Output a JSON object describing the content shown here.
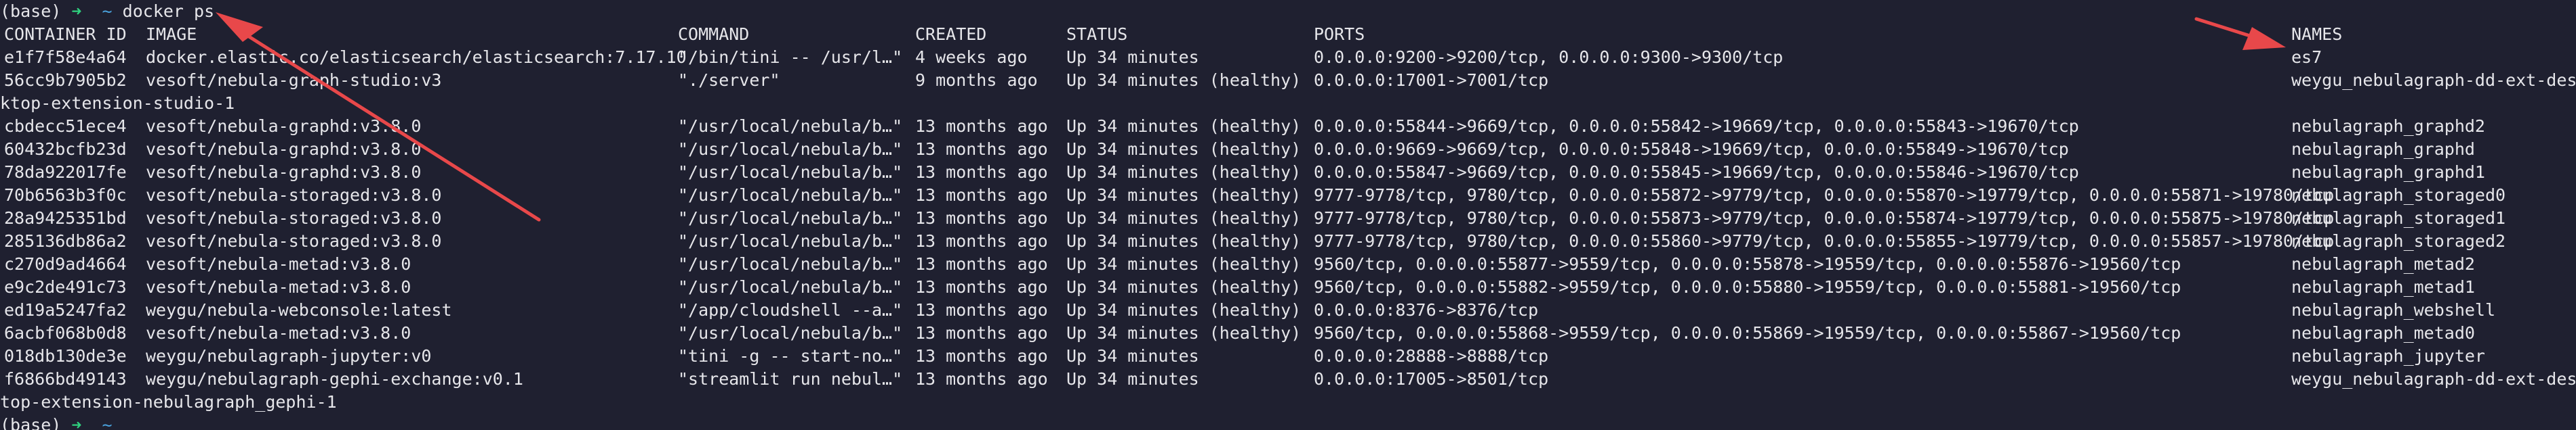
{
  "prompt_top": {
    "env": "(base)",
    "arrow": "➜",
    "cwd": "~",
    "command": "docker ps"
  },
  "headers": {
    "container_id": "CONTAINER ID",
    "image": "IMAGE",
    "command": "COMMAND",
    "created": "CREATED",
    "status": "STATUS",
    "ports": "PORTS",
    "names": "NAMES"
  },
  "rows": [
    {
      "container_id": "e1f7f58e4a64",
      "image": "docker.elastic.co/elasticsearch/elasticsearch:7.17.10",
      "command": "\"/bin/tini -- /usr/l…\"",
      "created": "4 weeks ago",
      "status": "Up 34 minutes",
      "ports": "0.0.0.0:9200->9200/tcp, 0.0.0.0:9300->9300/tcp",
      "names": "es7"
    },
    {
      "container_id": "56cc9b7905b2",
      "image": "vesoft/nebula-graph-studio:v3",
      "command": "\"./server\"",
      "created": "9 months ago",
      "status": "Up 34 minutes (healthy)",
      "ports": "0.0.0.0:17001->7001/tcp",
      "names": "weygu_nebulagraph-dd-ext-des"
    },
    {
      "wrap": "ktop-extension-studio-1"
    },
    {
      "container_id": "cbdecc51ece4",
      "image": "vesoft/nebula-graphd:v3.8.0",
      "command": "\"/usr/local/nebula/b…\"",
      "created": "13 months ago",
      "status": "Up 34 minutes (healthy)",
      "ports": "0.0.0.0:55844->9669/tcp, 0.0.0.0:55842->19669/tcp, 0.0.0.0:55843->19670/tcp",
      "names": "nebulagraph_graphd2"
    },
    {
      "container_id": "60432bcfb23d",
      "image": "vesoft/nebula-graphd:v3.8.0",
      "command": "\"/usr/local/nebula/b…\"",
      "created": "13 months ago",
      "status": "Up 34 minutes (healthy)",
      "ports": "0.0.0.0:9669->9669/tcp, 0.0.0.0:55848->19669/tcp, 0.0.0.0:55849->19670/tcp",
      "names": "nebulagraph_graphd"
    },
    {
      "container_id": "78da922017fe",
      "image": "vesoft/nebula-graphd:v3.8.0",
      "command": "\"/usr/local/nebula/b…\"",
      "created": "13 months ago",
      "status": "Up 34 minutes (healthy)",
      "ports": "0.0.0.0:55847->9669/tcp, 0.0.0.0:55845->19669/tcp, 0.0.0.0:55846->19670/tcp",
      "names": "nebulagraph_graphd1"
    },
    {
      "container_id": "70b6563b3f0c",
      "image": "vesoft/nebula-storaged:v3.8.0",
      "command": "\"/usr/local/nebula/b…\"",
      "created": "13 months ago",
      "status": "Up 34 minutes (healthy)",
      "ports": "9777-9778/tcp, 9780/tcp, 0.0.0.0:55872->9779/tcp, 0.0.0.0:55870->19779/tcp, 0.0.0.0:55871->19780/tcp",
      "names": "nebulagraph_storaged0"
    },
    {
      "container_id": "28a9425351bd",
      "image": "vesoft/nebula-storaged:v3.8.0",
      "command": "\"/usr/local/nebula/b…\"",
      "created": "13 months ago",
      "status": "Up 34 minutes (healthy)",
      "ports": "9777-9778/tcp, 9780/tcp, 0.0.0.0:55873->9779/tcp, 0.0.0.0:55874->19779/tcp, 0.0.0.0:55875->19780/tcp",
      "names": "nebulagraph_storaged1"
    },
    {
      "container_id": "285136db86a2",
      "image": "vesoft/nebula-storaged:v3.8.0",
      "command": "\"/usr/local/nebula/b…\"",
      "created": "13 months ago",
      "status": "Up 34 minutes (healthy)",
      "ports": "9777-9778/tcp, 9780/tcp, 0.0.0.0:55860->9779/tcp, 0.0.0.0:55855->19779/tcp, 0.0.0.0:55857->19780/tcp",
      "names": "nebulagraph_storaged2"
    },
    {
      "container_id": "c270d9ad4664",
      "image": "vesoft/nebula-metad:v3.8.0",
      "command": "\"/usr/local/nebula/b…\"",
      "created": "13 months ago",
      "status": "Up 34 minutes (healthy)",
      "ports": "9560/tcp, 0.0.0.0:55877->9559/tcp, 0.0.0.0:55878->19559/tcp, 0.0.0.0:55876->19560/tcp",
      "names": "nebulagraph_metad2"
    },
    {
      "container_id": "e9c2de491c73",
      "image": "vesoft/nebula-metad:v3.8.0",
      "command": "\"/usr/local/nebula/b…\"",
      "created": "13 months ago",
      "status": "Up 34 minutes (healthy)",
      "ports": "9560/tcp, 0.0.0.0:55882->9559/tcp, 0.0.0.0:55880->19559/tcp, 0.0.0.0:55881->19560/tcp",
      "names": "nebulagraph_metad1"
    },
    {
      "container_id": "ed19a5247fa2",
      "image": "weygu/nebula-webconsole:latest",
      "command": "\"/app/cloudshell --a…\"",
      "created": "13 months ago",
      "status": "Up 34 minutes (healthy)",
      "ports": "0.0.0.0:8376->8376/tcp",
      "names": "nebulagraph_webshell"
    },
    {
      "container_id": "6acbf068b0d8",
      "image": "vesoft/nebula-metad:v3.8.0",
      "command": "\"/usr/local/nebula/b…\"",
      "created": "13 months ago",
      "status": "Up 34 minutes (healthy)",
      "ports": "9560/tcp, 0.0.0.0:55868->9559/tcp, 0.0.0.0:55869->19559/tcp, 0.0.0.0:55867->19560/tcp",
      "names": "nebulagraph_metad0"
    },
    {
      "container_id": "018db130de3e",
      "image": "weygu/nebulagraph-jupyter:v0",
      "command": "\"tini -g -- start-no…\"",
      "created": "13 months ago",
      "status": "Up 34 minutes",
      "ports": "0.0.0.0:28888->8888/tcp",
      "names": "nebulagraph_jupyter"
    },
    {
      "container_id": "f6866bd49143",
      "image": "weygu/nebulagraph-gephi-exchange:v0.1",
      "command": "\"streamlit run nebul…\"",
      "created": "13 months ago",
      "status": "Up 34 minutes",
      "ports": "0.0.0.0:17005->8501/tcp",
      "names": "weygu_nebulagraph-dd-ext-desk"
    },
    {
      "wrap": "top-extension-nebulagraph_gephi-1"
    }
  ],
  "prompt_bottom": {
    "env": "(base)",
    "arrow": "➜",
    "cwd": "~"
  },
  "annotation": {
    "arrow_color": "#e8484a",
    "icon": "arrow-annotation-icon"
  }
}
